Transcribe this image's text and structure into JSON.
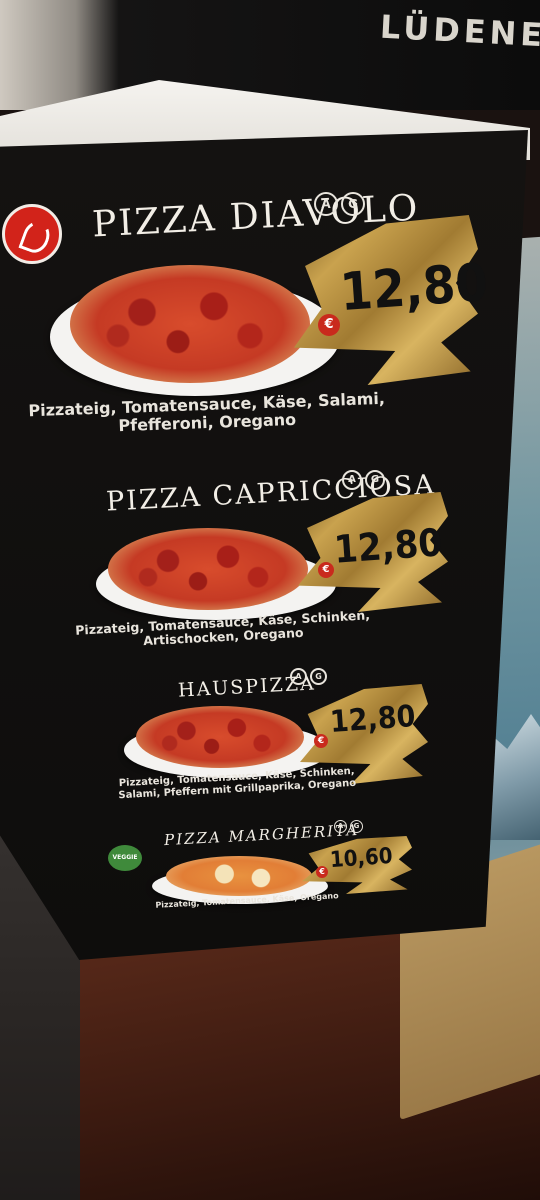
{
  "background": {
    "shirt_text": "LÜDENE"
  },
  "menu": {
    "items": [
      {
        "name": "PIZZA DIAVOLO",
        "allergens": [
          "A",
          "G"
        ],
        "price": "12,80",
        "currency": "€",
        "description_line1": "Pizzateig, Tomatensauce, Käse, Salami,",
        "description_line2": "Pfefferoni, Oregano",
        "badge": "chili-icon"
      },
      {
        "name": "PIZZA CAPRICCIOSA",
        "allergens": [
          "A",
          "G"
        ],
        "price": "12,80",
        "currency": "€",
        "description_line1": "Pizzateig, Tomatensauce, Käse, Schinken,",
        "description_line2": "Artischocken, Oregano"
      },
      {
        "name": "HAUSPIZZA",
        "allergens": [
          "A",
          "G"
        ],
        "price": "12,80",
        "currency": "€",
        "description_line1": "Pizzateig, Tomatensauce, Käse, Schinken,",
        "description_line2": "Salami, Pfeffern mit Grillpaprika, Oregano"
      },
      {
        "name": "PIZZA MARGHERITA",
        "allergens": [
          "A",
          "G"
        ],
        "price": "10,60",
        "currency": "€",
        "description_line1": "Pizzateig, Tomatensauce, Käse, Oregano",
        "badge": "veggie-icon",
        "badge_text": "VEGGIE"
      }
    ]
  },
  "colors": {
    "card": "#111010",
    "gold": "#c9a24e",
    "euro_badge": "#c92a1d"
  }
}
